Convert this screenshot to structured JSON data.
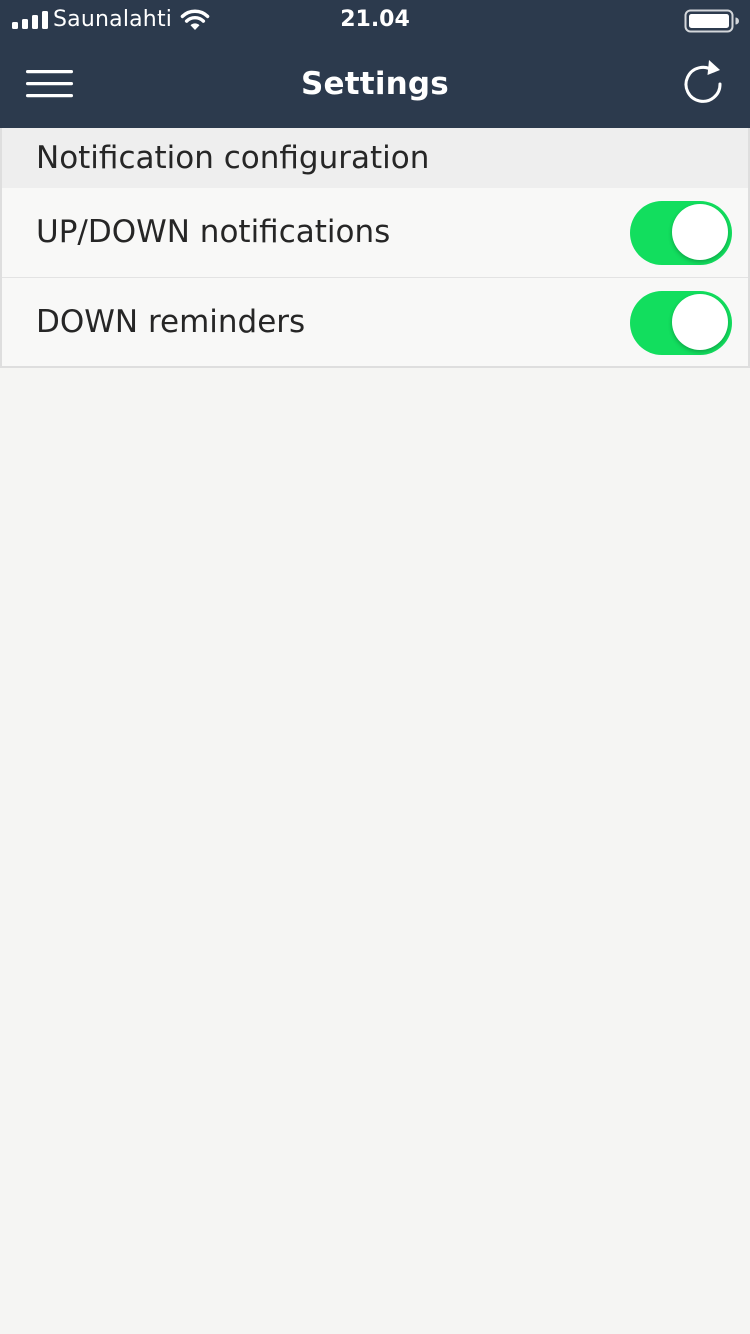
{
  "status_bar": {
    "carrier": "Saunalahti",
    "time": "21.04",
    "signal_icon": "cellular-signal-icon",
    "wifi_icon": "wifi-icon",
    "battery_icon": "battery-icon"
  },
  "navbar": {
    "title": "Settings",
    "menu_icon": "hamburger-menu-icon",
    "refresh_icon": "refresh-icon"
  },
  "settings": {
    "section_title": "Notification configuration",
    "items": [
      {
        "label": "UP/DOWN notifications",
        "enabled": true
      },
      {
        "label": "DOWN reminders",
        "enabled": true
      }
    ]
  },
  "colors": {
    "header_background": "#2c3a4d",
    "toggle_on": "#12de5e",
    "page_background": "#f5f5f3"
  }
}
